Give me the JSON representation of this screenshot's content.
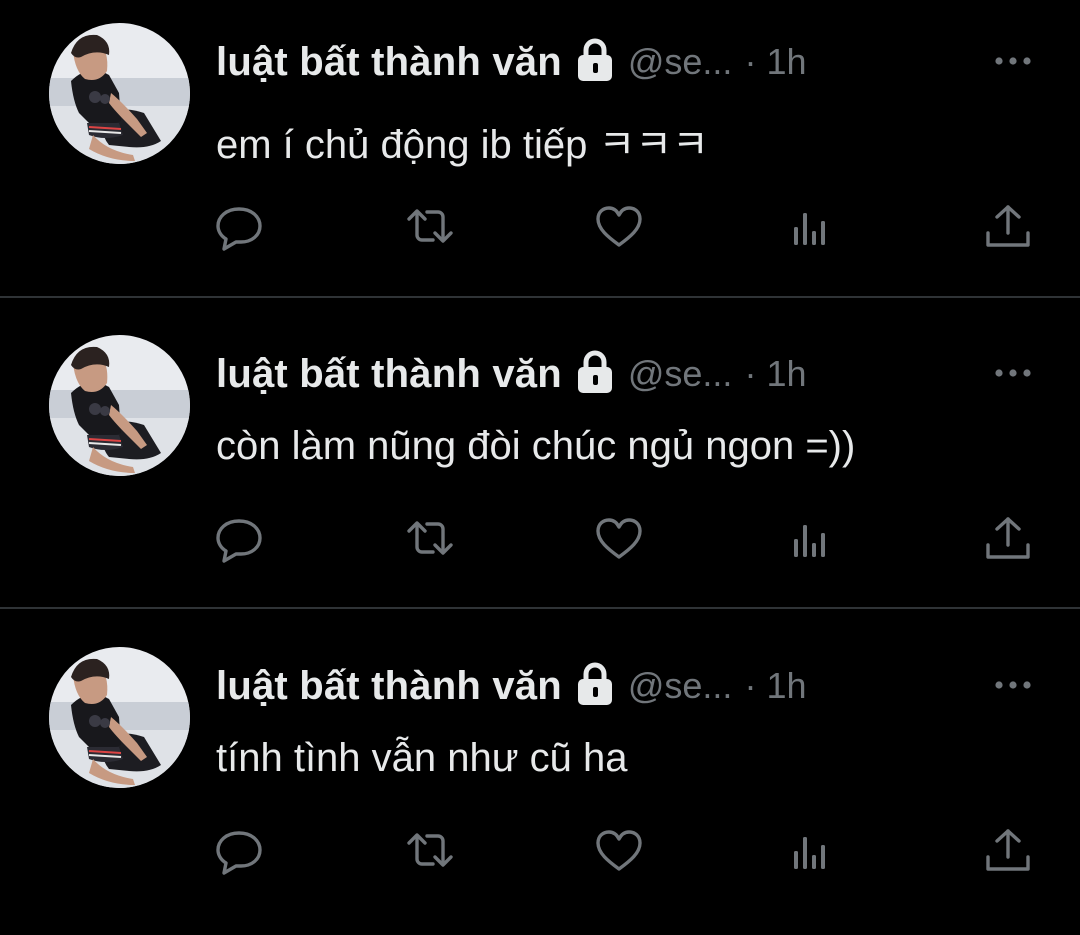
{
  "colors": {
    "background": "#000000",
    "text_primary": "#e7e9ea",
    "text_secondary": "#71767b",
    "divider": "#2f3336"
  },
  "tweets": [
    {
      "display_name": "luật bất thành văn",
      "handle": "@se...",
      "separator": "·",
      "time": "1h",
      "text": "em í chủ động ib tiếp ㅋㅋㅋ",
      "icons": [
        "lock-icon",
        "more-icon",
        "reply-icon",
        "retweet-icon",
        "like-icon",
        "views-icon",
        "share-icon"
      ]
    },
    {
      "display_name": "luật bất thành văn",
      "handle": "@se...",
      "separator": "·",
      "time": "1h",
      "text": "còn làm nũng đòi chúc ngủ ngon =))",
      "icons": [
        "lock-icon",
        "more-icon",
        "reply-icon",
        "retweet-icon",
        "like-icon",
        "views-icon",
        "share-icon"
      ]
    },
    {
      "display_name": "luật bất thành văn",
      "handle": "@se...",
      "separator": "·",
      "time": "1h",
      "text": "tính tình vẫn như cũ ha",
      "icons": [
        "lock-icon",
        "more-icon",
        "reply-icon",
        "retweet-icon",
        "like-icon",
        "views-icon",
        "share-icon"
      ]
    }
  ]
}
